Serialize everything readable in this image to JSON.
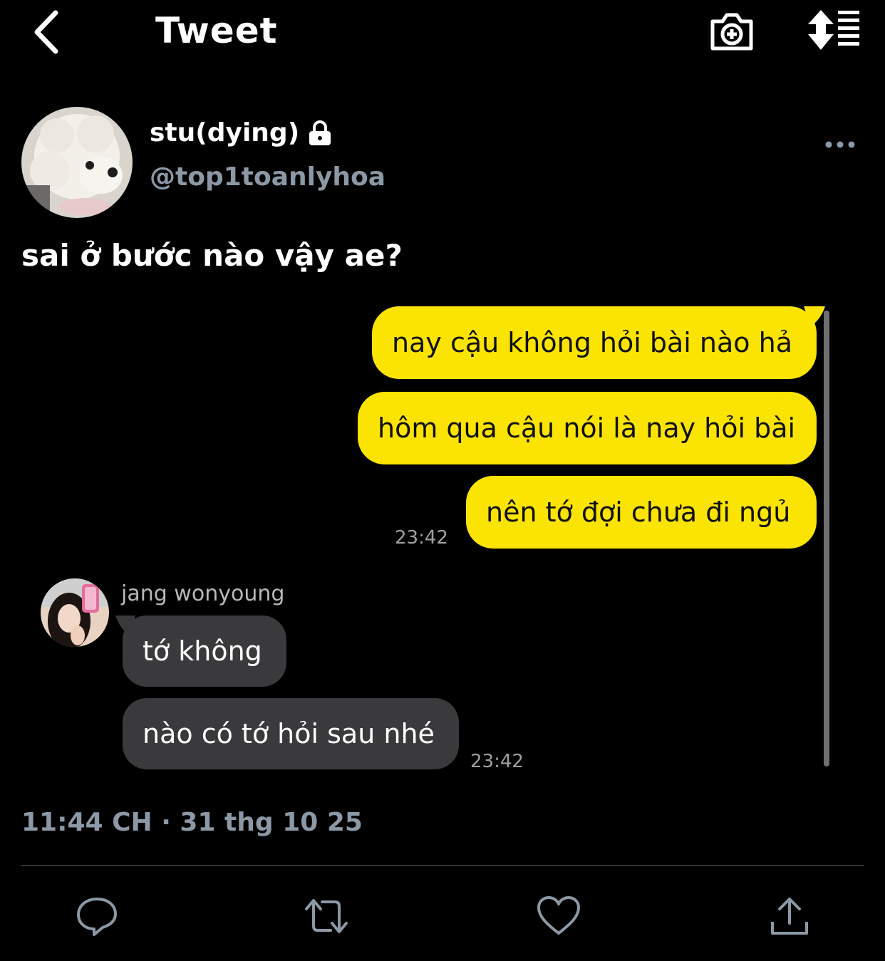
{
  "header": {
    "title": "Tweet",
    "back_icon": "chevron-left-icon",
    "camera_icon": "camera-plus-icon",
    "sort_icon": "sort-list-icon"
  },
  "author": {
    "display_name": "stu(dying)",
    "handle": "@top1toanlyhoa",
    "lock_icon": "lock-icon",
    "more_icon": "more-dots-icon"
  },
  "tweet": {
    "text": "sai ở bước nào vậy ae?",
    "timestamp": "11:44 CH · 31 thg 10 25"
  },
  "chat": {
    "outgoing": [
      "nay cậu không hỏi bài nào hả",
      "hôm qua cậu nói là nay hỏi bài",
      "nên tớ đợi chưa đi ngủ"
    ],
    "outgoing_time": "23:42",
    "sender_name": "jang wonyoung",
    "incoming": [
      "tớ không",
      "nào có tớ hỏi sau nhé"
    ],
    "incoming_time": "23:42",
    "colors": {
      "outgoing_bubble": "#fbe401",
      "incoming_bubble": "#3a3a3c"
    }
  },
  "actions": {
    "reply_icon": "reply-bubble-icon",
    "retweet_icon": "retweet-icon",
    "like_icon": "heart-icon",
    "share_icon": "share-icon"
  },
  "colors": {
    "background": "#000000",
    "muted": "#8b98a5"
  }
}
